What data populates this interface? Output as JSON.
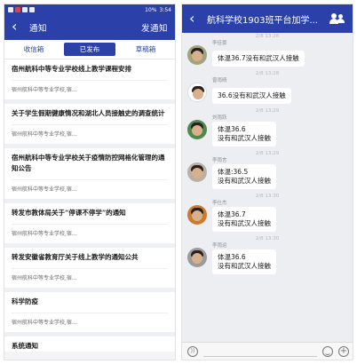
{
  "left": {
    "status": {
      "time": "3:54",
      "battery": "10%"
    },
    "nav": {
      "back": "‹",
      "title": "通知",
      "action": "发通知"
    },
    "tabs": [
      "收信箱",
      "已发布",
      "草稿箱"
    ],
    "active_tab_index": 1,
    "items": [
      {
        "title": "宿州航科中等专业学校线上教学课程安排",
        "sub": "宿州航科中等专业学校,宿…"
      },
      {
        "title": "关于学生假期健康情况和湖北人员接触史的调查统计",
        "sub": "宿州航科中等专业学校,宿…"
      },
      {
        "title": "宿州航科中等专业学校关于疫情防控网格化管理的通知公告",
        "sub": "宿州航科中等专业学校,宿…"
      },
      {
        "title": "转发市教体局关于“停课不停学”的通知",
        "sub": "宿州航科中等专业学校,宿…"
      },
      {
        "title": "转发安徽省教育厅关于线上教学的通知公共",
        "sub": "宿州航科中等专业学校,宿…"
      },
      {
        "title": "科学防疫",
        "sub": "宿州航科中等专业学校,宿…"
      },
      {
        "title": "系统通知",
        "sub": ""
      }
    ]
  },
  "right": {
    "nav": {
      "back": "‹",
      "title": "航科学校1903班平台加学..."
    },
    "messages": [
      {
        "timestamp": "2/8 13:28",
        "sender": "李佳豪",
        "lines": [
          "体温36.7没有和武汉人接触"
        ]
      },
      {
        "timestamp": "2/8 13:28",
        "sender": "曾雨晴",
        "lines": [
          "36.6没有和武汉人接触"
        ]
      },
      {
        "timestamp": "2/8 13:29",
        "sender": "刘雨跃",
        "lines": [
          "体温36.6",
          "没有和武汉人接触"
        ]
      },
      {
        "timestamp": "2/8 13:29",
        "sender": "李雨言",
        "lines": [
          "体温:36.5",
          "没有和武汉人接触"
        ]
      },
      {
        "timestamp": "2/8 13:30",
        "sender": "李仕杰",
        "lines": [
          "体温36.7",
          "没有和武汉人接触"
        ]
      },
      {
        "timestamp": "2/8 13:30",
        "sender": "李雨运",
        "lines": [
          "体温36.6",
          "没有和武汉人接触"
        ]
      }
    ],
    "input": {
      "voice": "))",
      "plus": "+"
    }
  },
  "colors": {
    "primary": "#2b40a8",
    "chat_bg": "#eceef1",
    "list_bg": "#f4f4f6"
  }
}
